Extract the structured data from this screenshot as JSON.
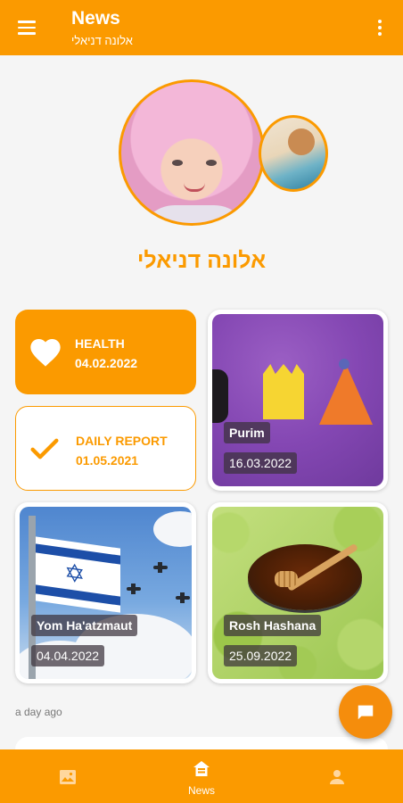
{
  "appbar": {
    "title": "News",
    "subtitle": "אלונה דניאלי",
    "menu_icon": "hamburger-menu-icon",
    "overflow_icon": "more-vertical-icon"
  },
  "profile": {
    "name": "אלונה דניאלי"
  },
  "cards": {
    "health": {
      "label": "HEALTH",
      "date": "04.02.2022",
      "icon": "heart-icon"
    },
    "daily_report": {
      "label": "DAILY REPORT",
      "date": "01.05.2021",
      "icon": "checkmark-icon"
    },
    "purim": {
      "title": "Purim",
      "date": "16.03.2022"
    },
    "yom_haatzmaut": {
      "title": "Yom Ha'atzmaut",
      "date": "04.04.2022"
    },
    "rosh_hashana": {
      "title": "Rosh Hashana",
      "date": "25.09.2022"
    }
  },
  "timestamp": "a day ago",
  "fab_icon": "chat-bubble-icon",
  "bottom_nav": {
    "gallery_icon": "image-icon",
    "news_icon": "home-icon",
    "news_label": "News",
    "profile_icon": "person-icon"
  },
  "colors": {
    "accent": "#fb9a00",
    "background": "#f5f5f5"
  }
}
